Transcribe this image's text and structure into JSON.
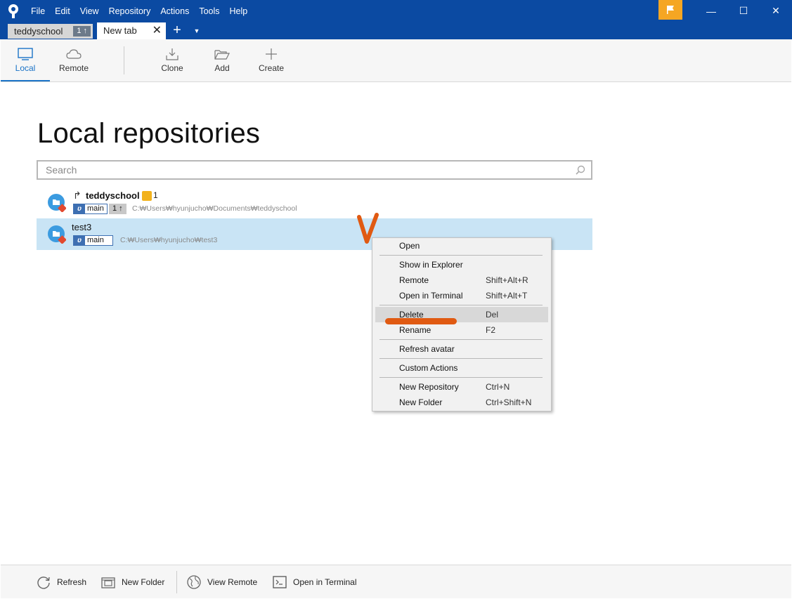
{
  "menu": [
    "File",
    "Edit",
    "View",
    "Repository",
    "Actions",
    "Tools",
    "Help"
  ],
  "tabs": {
    "repo_tab": {
      "label": "teddyschool",
      "badge": "1 ↑"
    },
    "new_tab": {
      "label": "New tab",
      "close": "✕"
    },
    "add": "+",
    "more": "▼"
  },
  "window": {
    "minimize": "—",
    "maximize": "☐",
    "close": "✕"
  },
  "toolbar": {
    "local": "Local",
    "remote": "Remote",
    "clone": "Clone",
    "add": "Add",
    "create": "Create"
  },
  "main": {
    "title": "Local repositories",
    "search_placeholder": "Search"
  },
  "repos": [
    {
      "name": "teddyschool",
      "branch": "main",
      "ahead": "1 ↑",
      "count": "1",
      "path": "C:₩Users₩hyunjucho₩Documents₩teddyschool",
      "arrow": "↱"
    },
    {
      "name": "test3",
      "branch": "main",
      "path": "C:₩Users₩hyunjucho₩test3"
    }
  ],
  "context_menu": {
    "open": "Open",
    "show_in_explorer": "Show in Explorer",
    "remote": "Remote",
    "remote_shortcut": "Shift+Alt+R",
    "open_in_terminal": "Open in Terminal",
    "open_in_terminal_shortcut": "Shift+Alt+T",
    "delete": "Delete",
    "delete_shortcut": "Del",
    "rename": "Rename",
    "rename_shortcut": "F2",
    "refresh_avatar": "Refresh avatar",
    "custom_actions": "Custom Actions",
    "new_repository": "New Repository",
    "new_repository_shortcut": "Ctrl+N",
    "new_folder": "New Folder",
    "new_folder_shortcut": "Ctrl+Shift+N"
  },
  "bottombar": {
    "refresh": "Refresh",
    "new_folder": "New Folder",
    "view_remote": "View Remote",
    "open_in_terminal": "Open in Terminal"
  },
  "colors": {
    "titlebar": "#0b4aa2",
    "selection": "#c9e4f5",
    "accent": "#1a73c7",
    "flag": "#f5a623",
    "annotation": "#e05a12"
  }
}
